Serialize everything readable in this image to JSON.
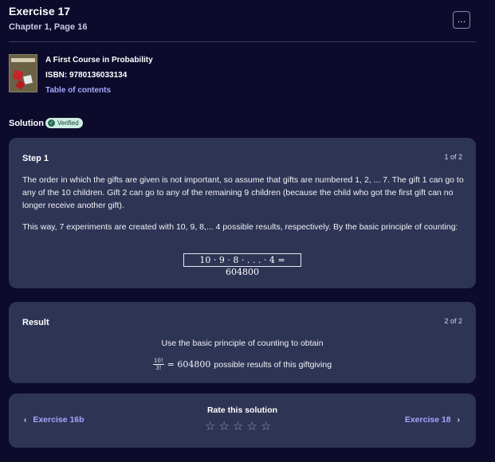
{
  "header": {
    "title": "Exercise 17",
    "subtitle": "Chapter 1, Page 16",
    "more_icon": "…"
  },
  "book": {
    "cover_icon": "book-cover-icon",
    "title": "A First Course in Probability",
    "isbn": "ISBN: 9780136033134",
    "toc_label": "Table of contents"
  },
  "solution": {
    "label": "Solution",
    "badge_check": "✓",
    "badge": "Verified"
  },
  "step1": {
    "title": "Step 1",
    "count": "1 of 2",
    "paragraph1": "The order in which the gifts are given is not important, so assume that gifts are numbered 1, 2, ... 7. The gift 1 can go to any of the 10 children. Gift 2 can go to any of the remaining 9 children (because the child who got the first gift can no longer receive another gift).",
    "paragraph2": "This way, 7 experiments are created with 10, 9, 8,... 4 possible results, respectively. By the basic principle of counting:",
    "formula": "10 · 9 · 8 · . . . · 4 = 604800"
  },
  "result": {
    "title": "Result",
    "count": "2 of 2",
    "line1": "Use the basic principle of counting to obtain",
    "frac_num": "10!",
    "frac_den": "3!",
    "equals": "= 604800",
    "line2_text": "possible results of this giftgiving"
  },
  "nav": {
    "prev_label": "Exercise 16b",
    "next_label": "Exercise 18",
    "prev_icon": "‹",
    "next_icon": "›",
    "rate_label": "Rate this solution",
    "stars": [
      "☆",
      "☆",
      "☆",
      "☆",
      "☆"
    ]
  },
  "colors": {
    "background": "#0d0b2c",
    "card": "#2e3454",
    "link": "#a7a6ff",
    "badge_bg": "#cdeee4"
  }
}
